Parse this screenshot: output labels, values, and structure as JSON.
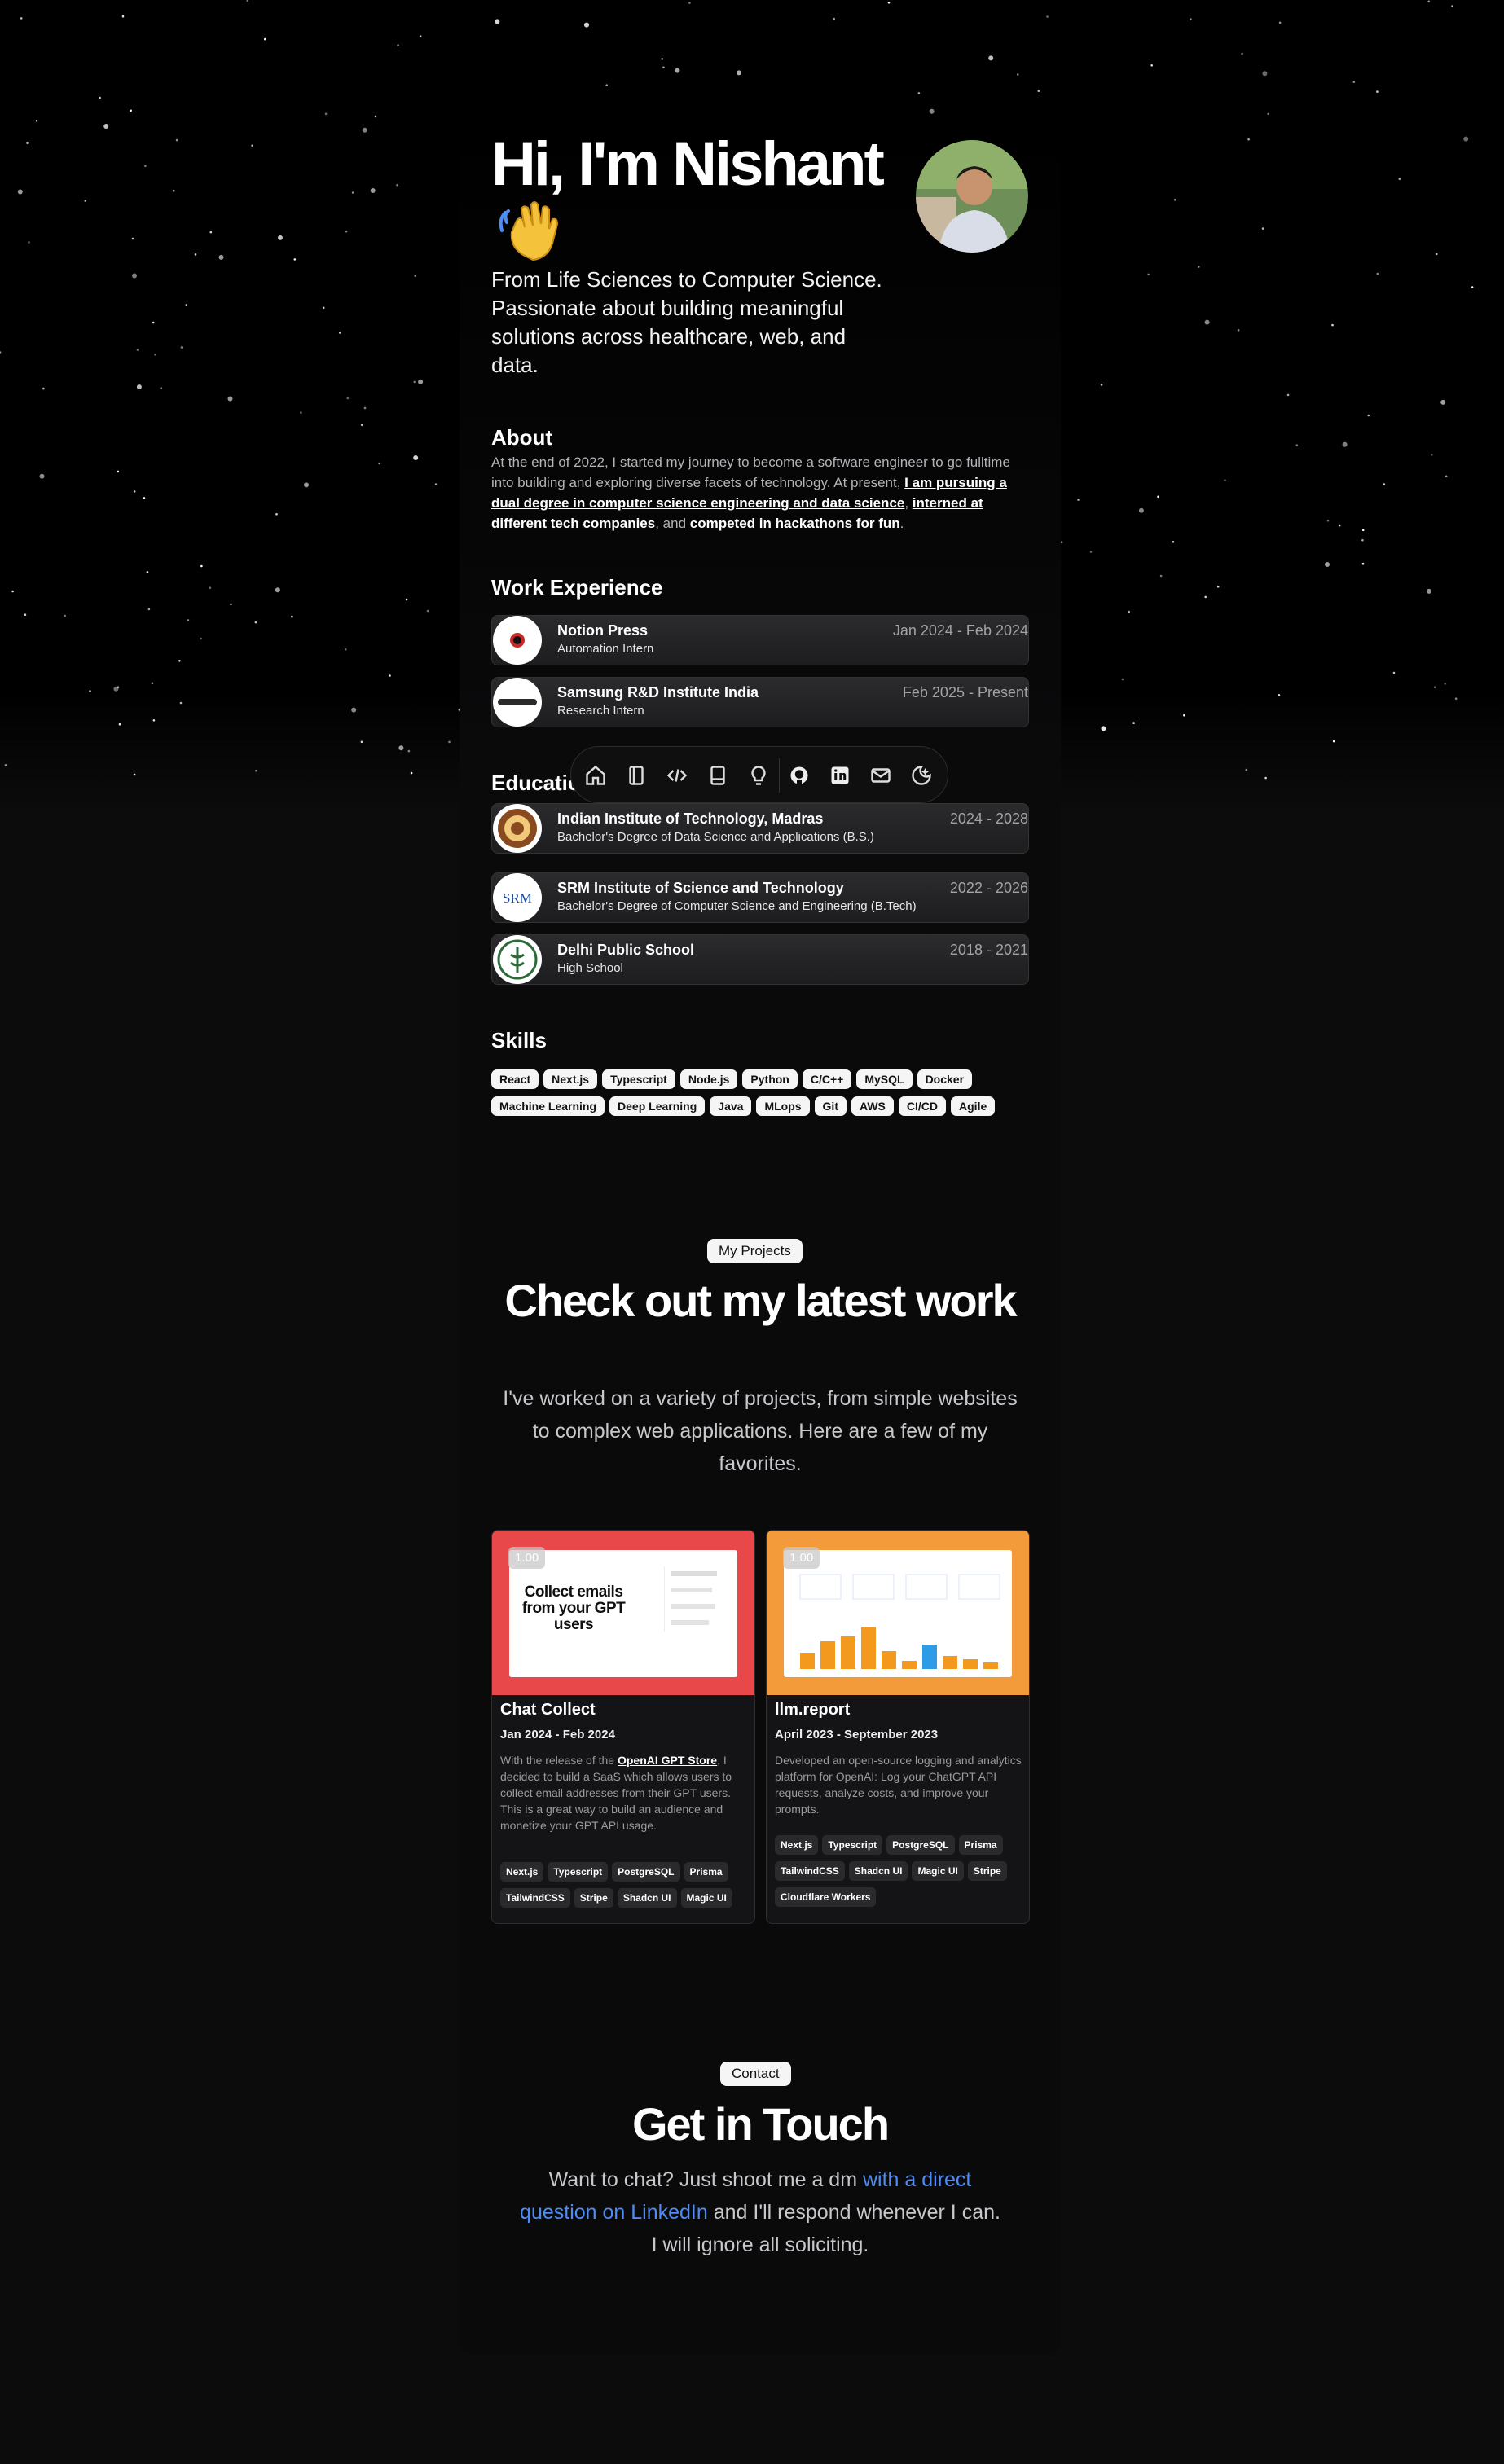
{
  "hero": {
    "title": "Hi, I'm Nishant",
    "subtitle": "From Life Sciences to Computer Science. Passionate about building meaningful solutions across healthcare, web, and data."
  },
  "about": {
    "heading": "About",
    "text_1": "At the end of 2022, I started my journey to become a software engineer to go fulltime into building and exploring diverse facets of technology. At present, ",
    "link_1": "I am pursuing a dual degree in computer science engineering and data science",
    "text_2": ", ",
    "link_2": "interned at different tech companies",
    "text_3": ", and ",
    "link_3": "competed in hackathons for fun",
    "text_4": "."
  },
  "work": {
    "heading": "Work Experience",
    "items": [
      {
        "company": "Notion Press",
        "role": "Automation Intern",
        "dates": "Jan 2024 - Feb 2024"
      },
      {
        "company": "Samsung R&D Institute India",
        "role": "Research Intern",
        "dates": "Feb 2025 - Present"
      }
    ]
  },
  "dock": {
    "icons": [
      "home-icon",
      "notebook-icon",
      "code-icon",
      "book-icon",
      "lightbulb-icon",
      "github-icon",
      "linkedin-icon",
      "mail-icon",
      "theme-toggle-icon"
    ]
  },
  "education": {
    "heading": "Education",
    "items": [
      {
        "school": "Indian Institute of Technology, Madras",
        "degree": "Bachelor's Degree of Data Science and Applications (B.S.)",
        "dates": "2024 - 2028"
      },
      {
        "school": "SRM Institute of Science and Technology",
        "degree": "Bachelor's Degree of Computer Science and Engineering (B.Tech)",
        "dates": "2022 - 2026"
      },
      {
        "school": "Delhi Public School",
        "degree": "High School",
        "dates": "2018 - 2021"
      }
    ]
  },
  "skills": {
    "heading": "Skills",
    "items": [
      "React",
      "Next.js",
      "Typescript",
      "Node.js",
      "Python",
      "C/C++",
      "MySQL",
      "Docker",
      "Machine Learning",
      "Deep Learning",
      "Java",
      "MLops",
      "Git",
      "AWS",
      "CI/CD",
      "Agile"
    ]
  },
  "projects": {
    "pill": "My Projects",
    "title": "Check out my latest work",
    "lead": "I've worked on a variety of projects, from simple websites to complex web applications. Here are a few of my favorites.",
    "cards": [
      {
        "badge": "1.00",
        "title": "Chat Collect",
        "dates": "Jan 2024 - Feb 2024",
        "desc_1": "With the release of the ",
        "desc_link": "OpenAI GPT Store",
        "desc_2": ", I decided to build a SaaS which allows users to collect email addresses from their GPT users. This is a great way to build an audience and monetize your GPT API usage.",
        "preview_text": "Collect emails from your GPT users",
        "tags": [
          "Next.js",
          "Typescript",
          "PostgreSQL",
          "Prisma",
          "TailwindCSS",
          "Stripe",
          "Shadcn UI",
          "Magic UI"
        ]
      },
      {
        "badge": "1.00",
        "title": "llm.report",
        "dates": "April 2023 - September 2023",
        "desc_1": "Developed an open-source logging and analytics platform for OpenAI: Log your ChatGPT API requests, analyze costs, and improve your prompts.",
        "tags": [
          "Next.js",
          "Typescript",
          "PostgreSQL",
          "Prisma",
          "TailwindCSS",
          "Shadcn UI",
          "Magic UI",
          "Stripe",
          "Cloudflare Workers"
        ]
      }
    ]
  },
  "contact": {
    "pill": "Contact",
    "title": "Get in Touch",
    "text_1": "Want to chat? Just shoot me a dm ",
    "link": "with a direct question on LinkedIn",
    "text_2": " and I'll respond whenever I can. I will ignore all soliciting."
  },
  "colors": {
    "background": "#0c0c0d",
    "link": "#4f8cf5",
    "card_red": "#e8484a",
    "card_orange": "#f39a3b"
  }
}
